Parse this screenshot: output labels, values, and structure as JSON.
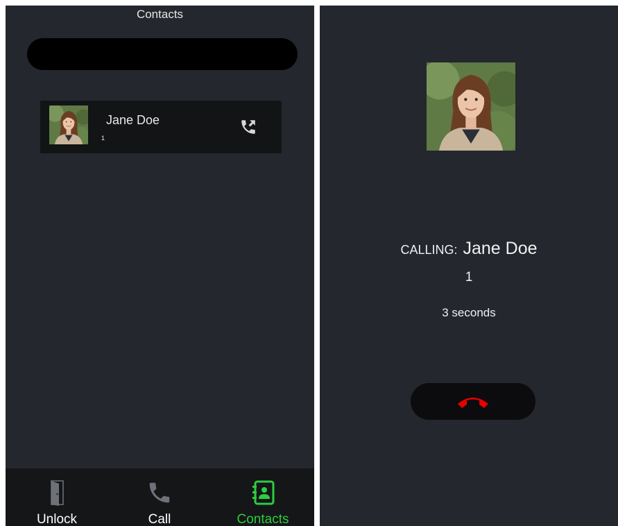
{
  "contacts_screen": {
    "title": "Contacts",
    "search": {
      "value": ""
    },
    "contacts": [
      {
        "name": "Jane Doe",
        "number": "1",
        "call_icon": "phone-outgoing-icon",
        "photo": "contact-photo"
      }
    ],
    "nav": {
      "items": [
        {
          "label": "Unlock",
          "icon": "door-icon",
          "active": false
        },
        {
          "label": "Call",
          "icon": "phone-icon",
          "active": false
        },
        {
          "label": "Contacts",
          "icon": "contacts-book-icon",
          "active": true
        }
      ]
    }
  },
  "call_screen": {
    "calling_label": "CALLING:",
    "name": "Jane Doe",
    "number": "1",
    "duration": "3 seconds",
    "hangup_icon": "hang-up-icon"
  },
  "colors": {
    "background": "#24272d",
    "card": "#121416",
    "nav_background": "#151618",
    "active_nav": "#2ecc40",
    "hangup": "#e60000"
  }
}
